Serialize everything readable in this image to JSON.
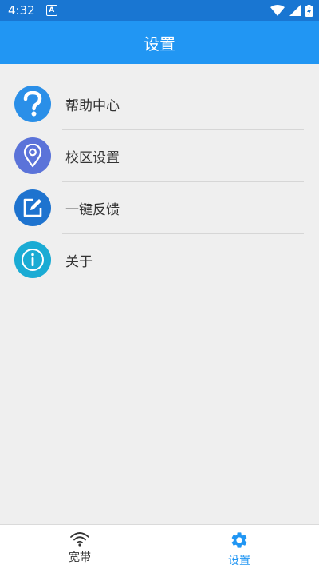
{
  "status_bar": {
    "time": "4:32",
    "indicator": "A"
  },
  "app_bar": {
    "title": "设置"
  },
  "menu": {
    "items": [
      {
        "label": "帮助中心",
        "icon": "help-question-icon",
        "color": "#2a8fe8"
      },
      {
        "label": "校区设置",
        "icon": "location-pin-icon",
        "color": "#5b73d9"
      },
      {
        "label": "一键反馈",
        "icon": "edit-feedback-icon",
        "color": "#1e73cf"
      },
      {
        "label": "关于",
        "icon": "info-icon",
        "color": "#1aabd4"
      }
    ]
  },
  "bottom_nav": {
    "tabs": [
      {
        "label": "宽带",
        "icon": "wifi-icon",
        "active": false
      },
      {
        "label": "设置",
        "icon": "gear-icon",
        "active": true
      }
    ],
    "active_color": "#2196f3",
    "inactive_color": "#333333"
  }
}
